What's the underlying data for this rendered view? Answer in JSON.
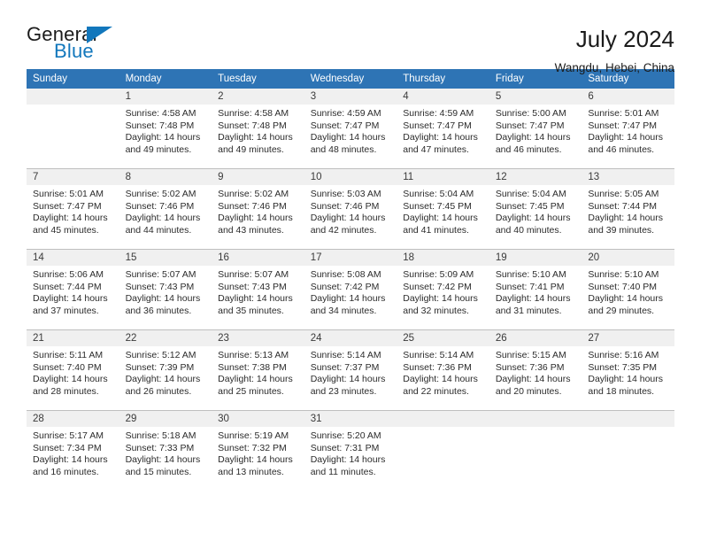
{
  "brand": {
    "name_top": "General",
    "name_bottom": "Blue",
    "triangle_icon": "triangle-icon",
    "accent_color": "#1277bc"
  },
  "header": {
    "title": "July 2024",
    "subtitle": "Wangdu, Hebei, China"
  },
  "calendar": {
    "header_bg": "#2e74b5",
    "daynum_bg": "#f0f0f0",
    "weekdays": [
      "Sunday",
      "Monday",
      "Tuesday",
      "Wednesday",
      "Thursday",
      "Friday",
      "Saturday"
    ],
    "weeks": [
      [
        {
          "day": "",
          "empty": true,
          "sunrise": "",
          "sunset": "",
          "daylight1": "",
          "daylight2": ""
        },
        {
          "day": "1",
          "sunrise": "Sunrise: 4:58 AM",
          "sunset": "Sunset: 7:48 PM",
          "daylight1": "Daylight: 14 hours",
          "daylight2": "and 49 minutes."
        },
        {
          "day": "2",
          "sunrise": "Sunrise: 4:58 AM",
          "sunset": "Sunset: 7:48 PM",
          "daylight1": "Daylight: 14 hours",
          "daylight2": "and 49 minutes."
        },
        {
          "day": "3",
          "sunrise": "Sunrise: 4:59 AM",
          "sunset": "Sunset: 7:47 PM",
          "daylight1": "Daylight: 14 hours",
          "daylight2": "and 48 minutes."
        },
        {
          "day": "4",
          "sunrise": "Sunrise: 4:59 AM",
          "sunset": "Sunset: 7:47 PM",
          "daylight1": "Daylight: 14 hours",
          "daylight2": "and 47 minutes."
        },
        {
          "day": "5",
          "sunrise": "Sunrise: 5:00 AM",
          "sunset": "Sunset: 7:47 PM",
          "daylight1": "Daylight: 14 hours",
          "daylight2": "and 46 minutes."
        },
        {
          "day": "6",
          "sunrise": "Sunrise: 5:01 AM",
          "sunset": "Sunset: 7:47 PM",
          "daylight1": "Daylight: 14 hours",
          "daylight2": "and 46 minutes."
        }
      ],
      [
        {
          "day": "7",
          "sunrise": "Sunrise: 5:01 AM",
          "sunset": "Sunset: 7:47 PM",
          "daylight1": "Daylight: 14 hours",
          "daylight2": "and 45 minutes."
        },
        {
          "day": "8",
          "sunrise": "Sunrise: 5:02 AM",
          "sunset": "Sunset: 7:46 PM",
          "daylight1": "Daylight: 14 hours",
          "daylight2": "and 44 minutes."
        },
        {
          "day": "9",
          "sunrise": "Sunrise: 5:02 AM",
          "sunset": "Sunset: 7:46 PM",
          "daylight1": "Daylight: 14 hours",
          "daylight2": "and 43 minutes."
        },
        {
          "day": "10",
          "sunrise": "Sunrise: 5:03 AM",
          "sunset": "Sunset: 7:46 PM",
          "daylight1": "Daylight: 14 hours",
          "daylight2": "and 42 minutes."
        },
        {
          "day": "11",
          "sunrise": "Sunrise: 5:04 AM",
          "sunset": "Sunset: 7:45 PM",
          "daylight1": "Daylight: 14 hours",
          "daylight2": "and 41 minutes."
        },
        {
          "day": "12",
          "sunrise": "Sunrise: 5:04 AM",
          "sunset": "Sunset: 7:45 PM",
          "daylight1": "Daylight: 14 hours",
          "daylight2": "and 40 minutes."
        },
        {
          "day": "13",
          "sunrise": "Sunrise: 5:05 AM",
          "sunset": "Sunset: 7:44 PM",
          "daylight1": "Daylight: 14 hours",
          "daylight2": "and 39 minutes."
        }
      ],
      [
        {
          "day": "14",
          "sunrise": "Sunrise: 5:06 AM",
          "sunset": "Sunset: 7:44 PM",
          "daylight1": "Daylight: 14 hours",
          "daylight2": "and 37 minutes."
        },
        {
          "day": "15",
          "sunrise": "Sunrise: 5:07 AM",
          "sunset": "Sunset: 7:43 PM",
          "daylight1": "Daylight: 14 hours",
          "daylight2": "and 36 minutes."
        },
        {
          "day": "16",
          "sunrise": "Sunrise: 5:07 AM",
          "sunset": "Sunset: 7:43 PM",
          "daylight1": "Daylight: 14 hours",
          "daylight2": "and 35 minutes."
        },
        {
          "day": "17",
          "sunrise": "Sunrise: 5:08 AM",
          "sunset": "Sunset: 7:42 PM",
          "daylight1": "Daylight: 14 hours",
          "daylight2": "and 34 minutes."
        },
        {
          "day": "18",
          "sunrise": "Sunrise: 5:09 AM",
          "sunset": "Sunset: 7:42 PM",
          "daylight1": "Daylight: 14 hours",
          "daylight2": "and 32 minutes."
        },
        {
          "day": "19",
          "sunrise": "Sunrise: 5:10 AM",
          "sunset": "Sunset: 7:41 PM",
          "daylight1": "Daylight: 14 hours",
          "daylight2": "and 31 minutes."
        },
        {
          "day": "20",
          "sunrise": "Sunrise: 5:10 AM",
          "sunset": "Sunset: 7:40 PM",
          "daylight1": "Daylight: 14 hours",
          "daylight2": "and 29 minutes."
        }
      ],
      [
        {
          "day": "21",
          "sunrise": "Sunrise: 5:11 AM",
          "sunset": "Sunset: 7:40 PM",
          "daylight1": "Daylight: 14 hours",
          "daylight2": "and 28 minutes."
        },
        {
          "day": "22",
          "sunrise": "Sunrise: 5:12 AM",
          "sunset": "Sunset: 7:39 PM",
          "daylight1": "Daylight: 14 hours",
          "daylight2": "and 26 minutes."
        },
        {
          "day": "23",
          "sunrise": "Sunrise: 5:13 AM",
          "sunset": "Sunset: 7:38 PM",
          "daylight1": "Daylight: 14 hours",
          "daylight2": "and 25 minutes."
        },
        {
          "day": "24",
          "sunrise": "Sunrise: 5:14 AM",
          "sunset": "Sunset: 7:37 PM",
          "daylight1": "Daylight: 14 hours",
          "daylight2": "and 23 minutes."
        },
        {
          "day": "25",
          "sunrise": "Sunrise: 5:14 AM",
          "sunset": "Sunset: 7:36 PM",
          "daylight1": "Daylight: 14 hours",
          "daylight2": "and 22 minutes."
        },
        {
          "day": "26",
          "sunrise": "Sunrise: 5:15 AM",
          "sunset": "Sunset: 7:36 PM",
          "daylight1": "Daylight: 14 hours",
          "daylight2": "and 20 minutes."
        },
        {
          "day": "27",
          "sunrise": "Sunrise: 5:16 AM",
          "sunset": "Sunset: 7:35 PM",
          "daylight1": "Daylight: 14 hours",
          "daylight2": "and 18 minutes."
        }
      ],
      [
        {
          "day": "28",
          "sunrise": "Sunrise: 5:17 AM",
          "sunset": "Sunset: 7:34 PM",
          "daylight1": "Daylight: 14 hours",
          "daylight2": "and 16 minutes."
        },
        {
          "day": "29",
          "sunrise": "Sunrise: 5:18 AM",
          "sunset": "Sunset: 7:33 PM",
          "daylight1": "Daylight: 14 hours",
          "daylight2": "and 15 minutes."
        },
        {
          "day": "30",
          "sunrise": "Sunrise: 5:19 AM",
          "sunset": "Sunset: 7:32 PM",
          "daylight1": "Daylight: 14 hours",
          "daylight2": "and 13 minutes."
        },
        {
          "day": "31",
          "sunrise": "Sunrise: 5:20 AM",
          "sunset": "Sunset: 7:31 PM",
          "daylight1": "Daylight: 14 hours",
          "daylight2": "and 11 minutes."
        },
        {
          "day": "",
          "empty": true,
          "sunrise": "",
          "sunset": "",
          "daylight1": "",
          "daylight2": ""
        },
        {
          "day": "",
          "empty": true,
          "sunrise": "",
          "sunset": "",
          "daylight1": "",
          "daylight2": ""
        },
        {
          "day": "",
          "empty": true,
          "sunrise": "",
          "sunset": "",
          "daylight1": "",
          "daylight2": ""
        }
      ]
    ]
  }
}
